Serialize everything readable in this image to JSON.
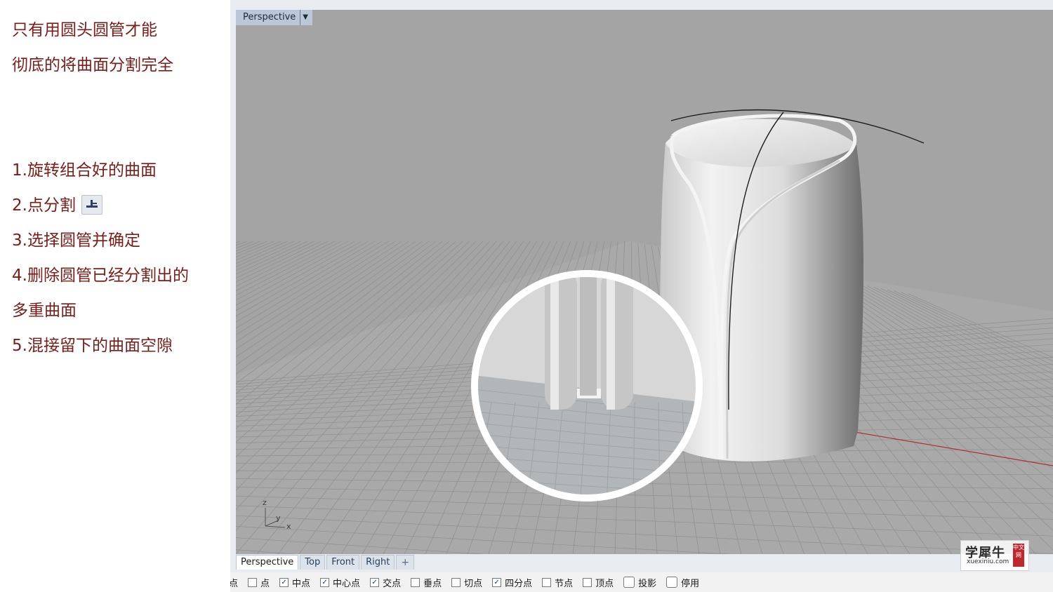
{
  "left_panel": {
    "intro_line1": "只有用圆头圆管才能",
    "intro_line2": "彻底的将曲面分割完全",
    "steps": [
      "1.旋转组合好的曲面",
      "2.点分割",
      "3.选择圆管并确定",
      "4.删除圆管已经分割出的",
      "多重曲面",
      "5.混接留下的曲面空隙"
    ],
    "step2_icon": "split-at-point-icon",
    "text_color": "#7a1c18"
  },
  "viewport": {
    "title": "Perspective",
    "axes": {
      "z": "z",
      "y": "y",
      "x": "x"
    },
    "background_color": "#a4a4a4"
  },
  "view_tabs": [
    "Perspective",
    "Top",
    "Front",
    "Right"
  ],
  "add_tab_icon": "plus-icon",
  "snap_bar": [
    {
      "label": "点",
      "checked": false,
      "partial_prefix": "点"
    },
    {
      "label": "点",
      "checked": false
    },
    {
      "label": "中点",
      "checked": true
    },
    {
      "label": "中心点",
      "checked": true
    },
    {
      "label": "交点",
      "checked": true
    },
    {
      "label": "垂点",
      "checked": false
    },
    {
      "label": "切点",
      "checked": false
    },
    {
      "label": "四分点",
      "checked": true
    },
    {
      "label": "节点",
      "checked": false
    },
    {
      "label": "顶点",
      "checked": false
    },
    {
      "label": "投影",
      "checked": false
    },
    {
      "label": "停用",
      "checked": false
    }
  ],
  "watermark": {
    "main": "学犀牛",
    "sub": "xuexiniu.com",
    "seal": "中文网"
  }
}
